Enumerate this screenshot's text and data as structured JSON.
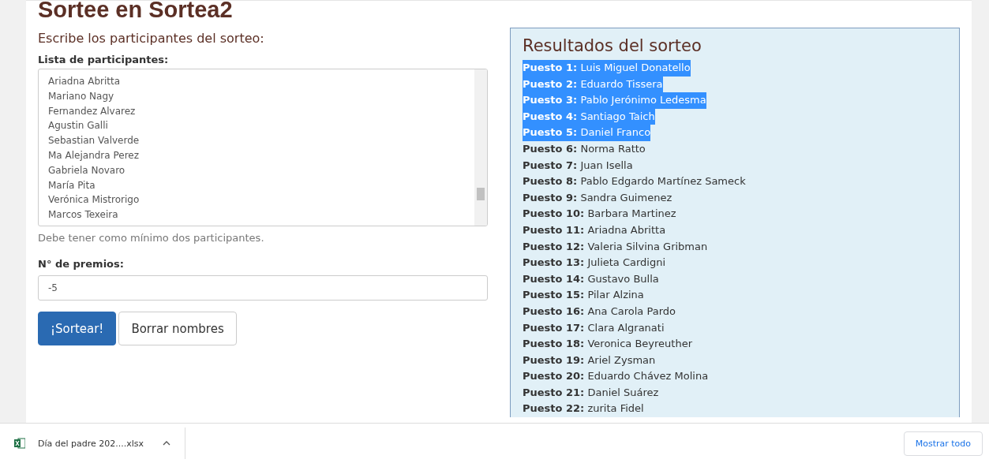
{
  "page_title": "Sortee en Sortea2",
  "form": {
    "heading": "Escribe los participantes del sorteo:",
    "list_label": "Lista de participantes:",
    "participants": [
      "Ariadna Abritta",
      "Mariano Nagy",
      "Fernandez Alvarez",
      "Agustin Galli",
      "Sebastian Valverde",
      "Ma Alejandra Perez",
      "Gabriela Novaro",
      "María Pita",
      "Verónica Mistrorigo",
      "Marcos Texeira"
    ],
    "hint": "Debe tener como mínimo dos participantes.",
    "prizes_label": "N° de premios:",
    "prizes_value": "-5",
    "buttons": [
      {
        "label": "¡Sortear!",
        "kind": "primary"
      },
      {
        "label": "Borrar nombres",
        "kind": "secondary"
      }
    ]
  },
  "results": {
    "title": "Resultados del sorteo",
    "rows": [
      {
        "label": "Puesto 1:",
        "name": "Luis Miguel Donatello",
        "selected": true
      },
      {
        "label": "Puesto 2:",
        "name": "Eduardo Tissera",
        "selected": true
      },
      {
        "label": "Puesto 3:",
        "name": "Pablo Jerónimo Ledesma",
        "selected": true
      },
      {
        "label": "Puesto 4:",
        "name": "Santiago Taich",
        "selected": true
      },
      {
        "label": "Puesto 5:",
        "name": "Daniel Franco",
        "selected": true
      },
      {
        "label": "Puesto 6:",
        "name": "Norma Ratto",
        "selected": false
      },
      {
        "label": "Puesto 7:",
        "name": "Juan Isella",
        "selected": false
      },
      {
        "label": "Puesto 8:",
        "name": "Pablo Edgardo Martínez Sameck",
        "selected": false
      },
      {
        "label": "Puesto 9:",
        "name": "Sandra Guimenez",
        "selected": false
      },
      {
        "label": "Puesto 10:",
        "name": "Barbara Martinez",
        "selected": false
      },
      {
        "label": "Puesto 11:",
        "name": "Ariadna Abritta",
        "selected": false
      },
      {
        "label": "Puesto 12:",
        "name": "Valeria Silvina Gribman",
        "selected": false
      },
      {
        "label": "Puesto 13:",
        "name": "Julieta Cardigni",
        "selected": false
      },
      {
        "label": "Puesto 14:",
        "name": "Gustavo Bulla",
        "selected": false
      },
      {
        "label": "Puesto 15:",
        "name": "Pilar Alzina",
        "selected": false
      },
      {
        "label": "Puesto 16:",
        "name": "Ana Carola Pardo",
        "selected": false
      },
      {
        "label": "Puesto 17:",
        "name": "Clara Algranati",
        "selected": false
      },
      {
        "label": "Puesto 18:",
        "name": "Veronica Beyreuther",
        "selected": false
      },
      {
        "label": "Puesto 19:",
        "name": "Ariel Zysman",
        "selected": false
      },
      {
        "label": "Puesto 20:",
        "name": "Eduardo Chávez Molina",
        "selected": false
      },
      {
        "label": "Puesto 21:",
        "name": "Daniel Suárez",
        "selected": false
      },
      {
        "label": "Puesto 22:",
        "name": "zurita Fidel",
        "selected": false
      }
    ]
  },
  "download_bar": {
    "file": "Día del padre 202....xlsx",
    "show_all": "Mostrar todo"
  }
}
